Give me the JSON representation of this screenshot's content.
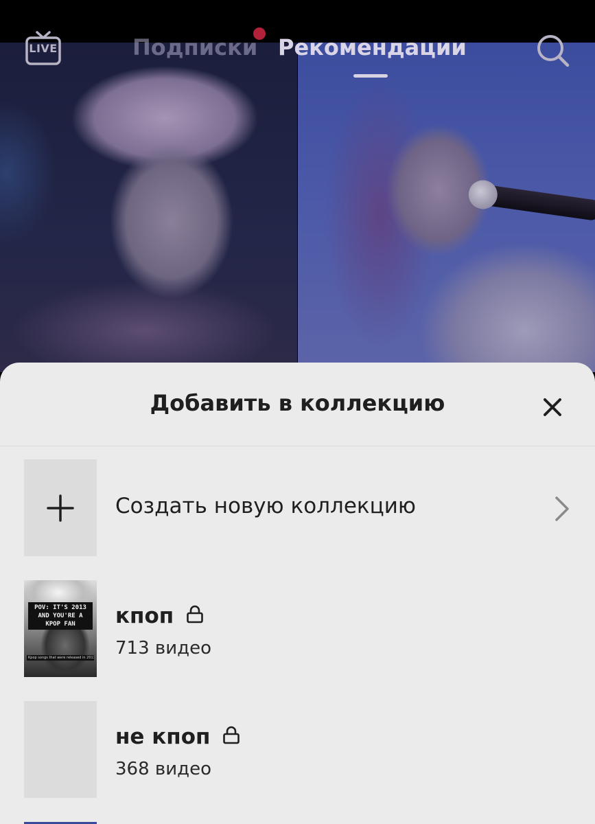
{
  "top_nav": {
    "live_label": "LIVE",
    "tabs": [
      {
        "label": "Подписки",
        "active": false,
        "has_notification_dot": true
      },
      {
        "label": "Рекомендации",
        "active": true
      }
    ],
    "search_icon": "search-icon"
  },
  "sheet": {
    "title": "Добавить в коллекцию",
    "close_icon": "close-icon",
    "create": {
      "label": "Создать новую коллекцию",
      "icon": "plus-icon",
      "chevron": "chevron-right-icon"
    },
    "collections": [
      {
        "name": "кпоп",
        "count": "713 видео",
        "private": true,
        "cover_caption": "POV: IT'S 2013 AND YOU'RE A KPOP FAN",
        "cover_subcaption": "Kpop songs that were released in 2013"
      },
      {
        "name": "не кпоп",
        "count": "368 видео",
        "private": true
      }
    ]
  },
  "colors": {
    "sheet_background": "#ebebeb",
    "notification_dot": "#b2213a",
    "text_primary": "#1f1f1f"
  }
}
